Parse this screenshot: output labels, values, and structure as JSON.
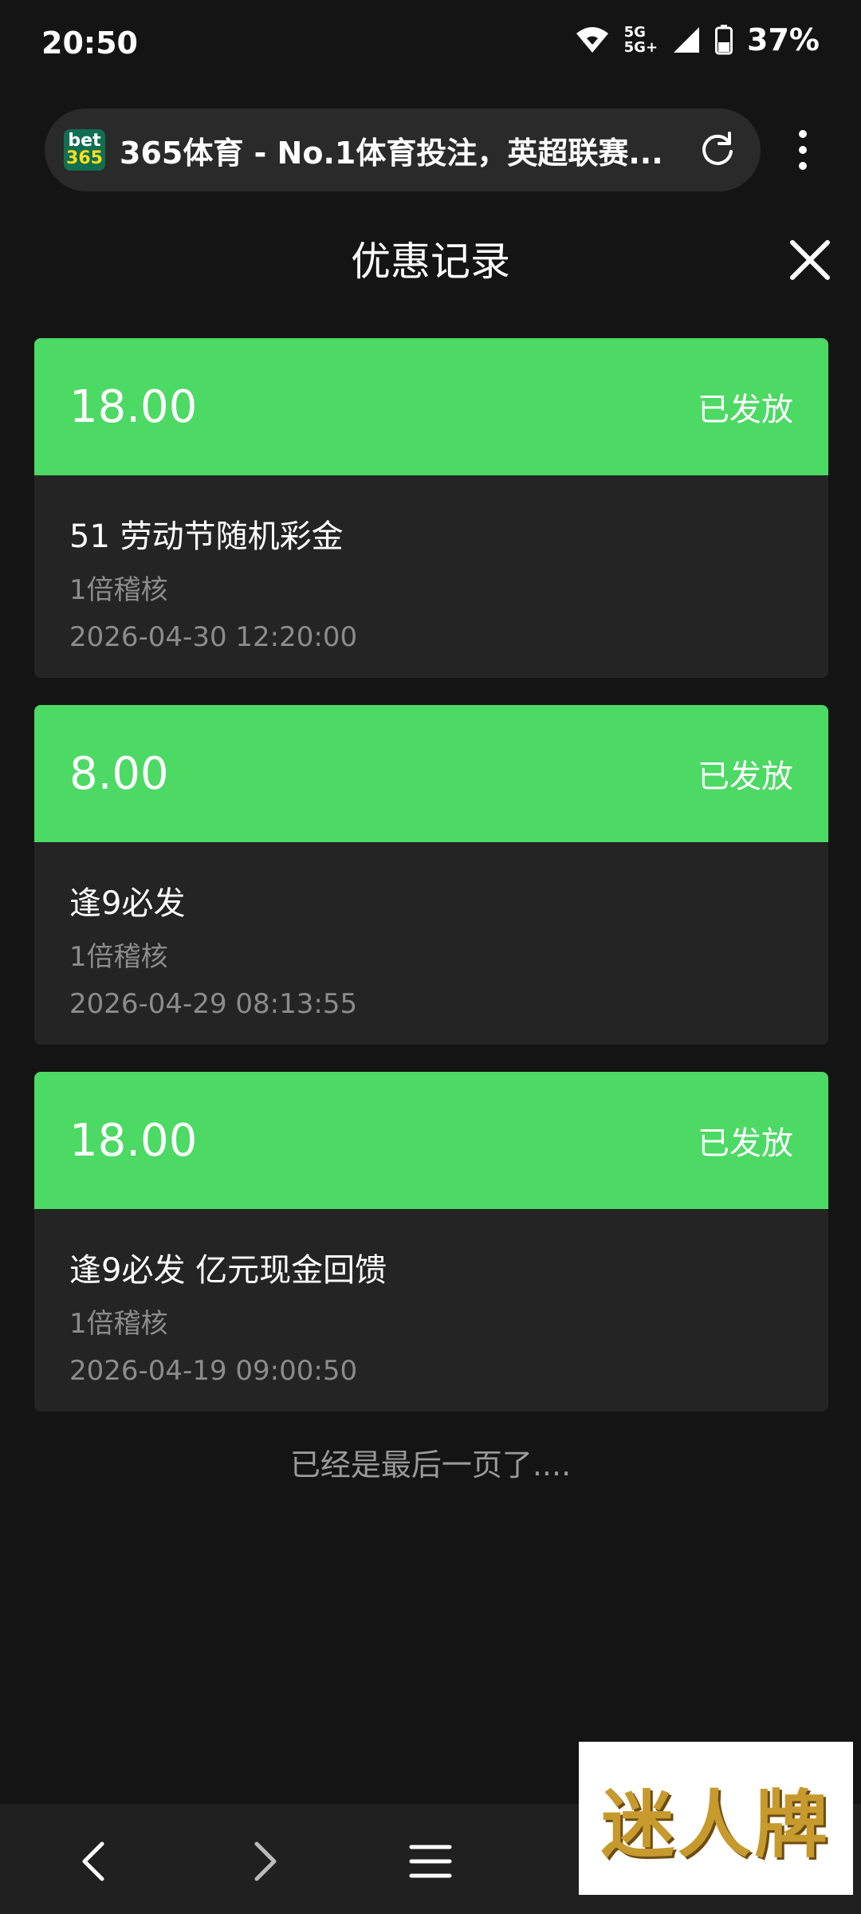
{
  "status_bar": {
    "time": "20:50",
    "network_top": "5G",
    "network_bottom": "5G+",
    "battery": "37%"
  },
  "browser": {
    "favicon_line1": "bet",
    "favicon_line2": "365",
    "title": "365体育 - No.1体育投注，英超联赛..."
  },
  "page": {
    "title": "优惠记录",
    "end_note": "已经是最后一页了...."
  },
  "records": [
    {
      "amount": "18.00",
      "status": "已发放",
      "name": "51 劳动节随机彩金",
      "audit": "1倍稽核",
      "date": "2026-04-30 12:20:00"
    },
    {
      "amount": "8.00",
      "status": "已发放",
      "name": "逢9必发",
      "audit": "1倍稽核",
      "date": "2026-04-29 08:13:55"
    },
    {
      "amount": "18.00",
      "status": "已发放",
      "name": "逢9必发 亿元现金回馈",
      "audit": "1倍稽核",
      "date": "2026-04-19 09:00:50"
    }
  ],
  "watermark": "迷人牌",
  "colors": {
    "accent": "#4cd964",
    "background": "#141414",
    "card": "#242424"
  }
}
